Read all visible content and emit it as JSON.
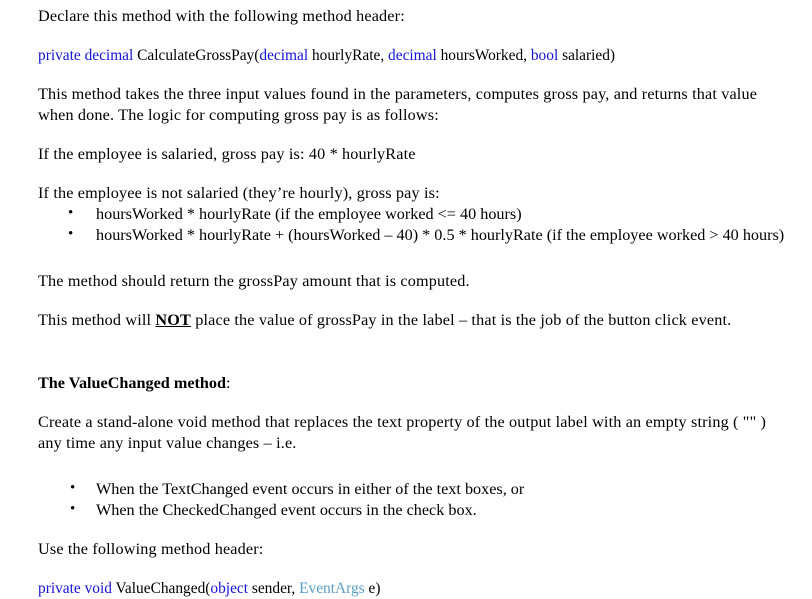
{
  "document": {
    "background_color": "#ffffff",
    "text_color": "#000000",
    "keyword_color": "#1414d6",
    "soft_type_color": "#5a9ec4",
    "intro_line": "Declare this method with the following method header:",
    "code_header_1": {
      "kw_private_decimal": "private decimal",
      "name": " CalculateGrossPay(",
      "kw_decimal_1": "decimal",
      "param_1": " hourlyRate, ",
      "kw_decimal_2": "decimal",
      "param_2": " hoursWorked, ",
      "kw_bool": "bool",
      "param_3": " salaried)"
    },
    "paragraph_takes_values": "This method takes the three input values found in the parameters, computes gross pay, and returns that value when done.    The logic for computing gross pay is as follows:",
    "salaried_rule": "If the employee is salaried, gross pay is:  40 * hourlyRate",
    "hourly_intro": "If the employee is not salaried (they’re hourly),  gross pay is:",
    "hourly_bullets": [
      "hoursWorked  * hourlyRate            (if the employee worked <=  40 hours)",
      "hoursWorked * hourlyRate  + (hoursWorked – 40) * 0.5 * hourlyRate   (if the employee worked  > 40 hours)"
    ],
    "return_note": "The method should return the grossPay amount that is computed.",
    "not_note": {
      "before": "This method will ",
      "emphasis": "NOT",
      "after": " place the value of grossPay in the label – that is the job of the button click event."
    },
    "section_heading": {
      "bold": "The ValueChanged method",
      "colon": ":"
    },
    "valuechanged_description": "Create a stand-alone void method that replaces the text property of the output label with an empty string ( \"\" ) any time any input value changes – i.e.",
    "event_bullets": [
      "When the TextChanged event occurs in either of the text boxes, or",
      "When the CheckedChanged event occurs in the check box."
    ],
    "use_header_line": "Use the following method header:",
    "code_header_2": {
      "kw_private_void": "private void",
      "name": " ValueChanged(",
      "kw_object": "object",
      "param_1": " sender, ",
      "type_eventargs": "EventArgs",
      "param_2": " e)"
    }
  }
}
